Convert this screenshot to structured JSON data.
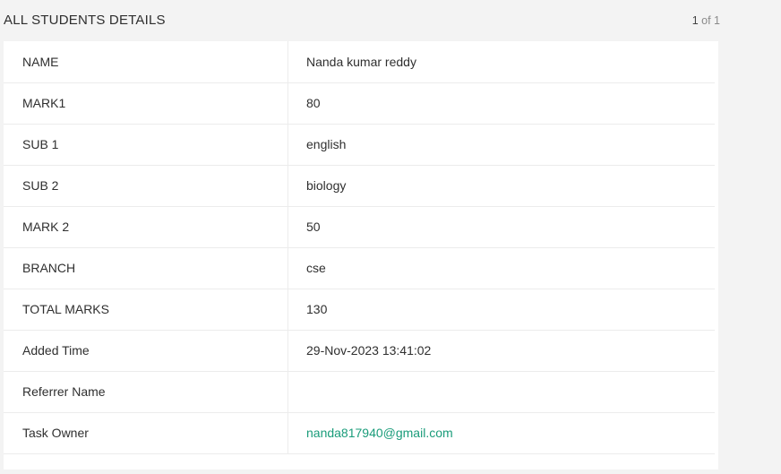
{
  "header": {
    "title": "ALL STUDENTS DETAILS",
    "page_current": "1",
    "page_sep": " of ",
    "page_total": "1"
  },
  "record": [
    {
      "label": "NAME",
      "value": "Nanda kumar reddy"
    },
    {
      "label": "MARK1",
      "value": "80"
    },
    {
      "label": "SUB 1",
      "value": "english"
    },
    {
      "label": "SUB 2",
      "value": "biology"
    },
    {
      "label": "MARK 2",
      "value": "50"
    },
    {
      "label": "BRANCH",
      "value": "cse"
    },
    {
      "label": "TOTAL MARKS",
      "value": "130"
    },
    {
      "label": "Added Time",
      "value": "29-Nov-2023 13:41:02"
    },
    {
      "label": "Referrer Name",
      "value": ""
    },
    {
      "label": "Task Owner",
      "value": "nanda817940@gmail.com",
      "is_link": true
    }
  ],
  "colors": {
    "link": "#1a9c7a",
    "background": "#f3f3f3",
    "card": "#ffffff"
  }
}
